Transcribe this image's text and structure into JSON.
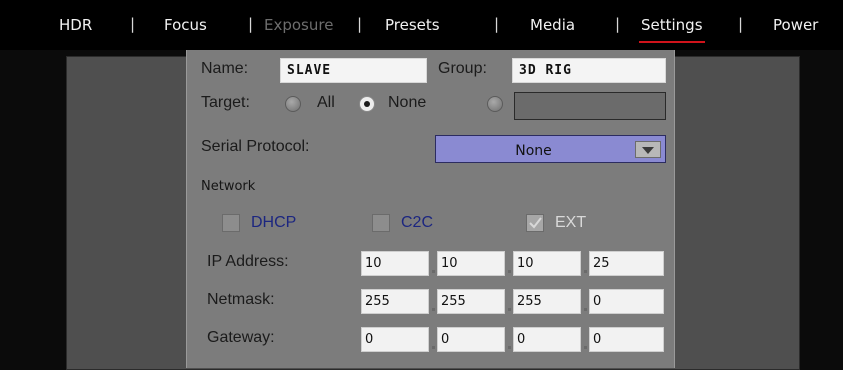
{
  "menu": {
    "items": [
      {
        "label": "HDR",
        "state": "normal"
      },
      {
        "label": "Focus",
        "state": "normal"
      },
      {
        "label": "Exposure",
        "state": "disabled"
      },
      {
        "label": "Presets",
        "state": "normal"
      },
      {
        "label": "Media",
        "state": "normal"
      },
      {
        "label": "Settings",
        "state": "active"
      },
      {
        "label": "Power",
        "state": "normal"
      }
    ],
    "separator": "|",
    "active_underline_color": "#d0131b"
  },
  "dialog": {
    "name_label": "Name:",
    "name_value": "SLAVE",
    "group_label": "Group:",
    "group_value": "3D RIG",
    "target_label": "Target:",
    "target_options": [
      {
        "label": "All",
        "checked": false
      },
      {
        "label": "None",
        "checked": true
      },
      {
        "label": "",
        "checked": false
      }
    ],
    "target_custom_value": "",
    "serial_protocol_label": "Serial Protocol:",
    "serial_protocol_value": "None",
    "network_heading": "Network",
    "checkboxes": [
      {
        "label": "DHCP",
        "checked": false
      },
      {
        "label": "C2C",
        "checked": false
      },
      {
        "label": "EXT",
        "checked": true
      }
    ],
    "rows": [
      {
        "label": "IP Address:",
        "octets": [
          "10",
          "10",
          "10",
          "25"
        ]
      },
      {
        "label": "Netmask:",
        "octets": [
          "255",
          "255",
          "255",
          "0"
        ]
      },
      {
        "label": "Gateway:",
        "octets": [
          "0",
          "0",
          "0",
          "0"
        ]
      }
    ]
  },
  "icons": {
    "dropdown": "chevron-down-icon",
    "checkmark": "checkmark-icon"
  }
}
